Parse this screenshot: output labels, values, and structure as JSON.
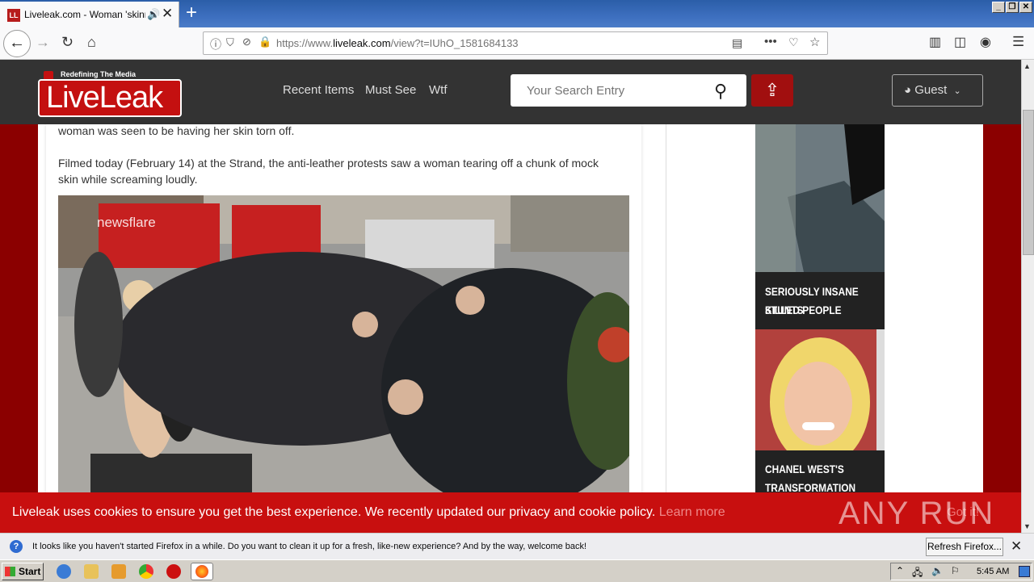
{
  "browser": {
    "tab_title": "Liveleak.com - Woman 'skinned",
    "url_prefix": "https://www.",
    "url_domain": "liveleak.com",
    "url_path": "/view?t=IUhO_1581684133"
  },
  "site": {
    "logo_tagline": "Redefining The Media",
    "logo_text": "LiveLeak",
    "nav": [
      "Recent Items",
      "Must See",
      "Wtf"
    ],
    "search_placeholder": "Your Search Entry",
    "guest_label": "Guest"
  },
  "article": {
    "para_top": "woman was seen to be having her skin torn off.",
    "para_main_line1": "Filmed today (February 14) at the Strand, the anti-leather protests saw a woman tearing off a chunk of mock",
    "para_main_line2": "skin while screaming loudly.",
    "photo_watermark": "newsflare"
  },
  "sidebar": {
    "card1_line1": "SERIOUSLY INSANE STUNTS",
    "card1_line2": "KILLED PEOPLE",
    "card2_line1": "CHANEL WEST'S",
    "card2_line2": "TRANSFORMATION IS"
  },
  "cookie": {
    "text": "Liveleak uses cookies to ensure you get the best experience. We recently updated our privacy and cookie policy.",
    "link": "Learn more",
    "button": "Got it!"
  },
  "watermark": "ANY RUN",
  "notification": {
    "text": "It looks like you haven't started Firefox in a while. Do you want to clean it up for a fresh, like-new experience? And by the way, welcome back!",
    "button": "Refresh Firefox..."
  },
  "taskbar": {
    "start": "Start",
    "clock": "5:45 AM"
  }
}
